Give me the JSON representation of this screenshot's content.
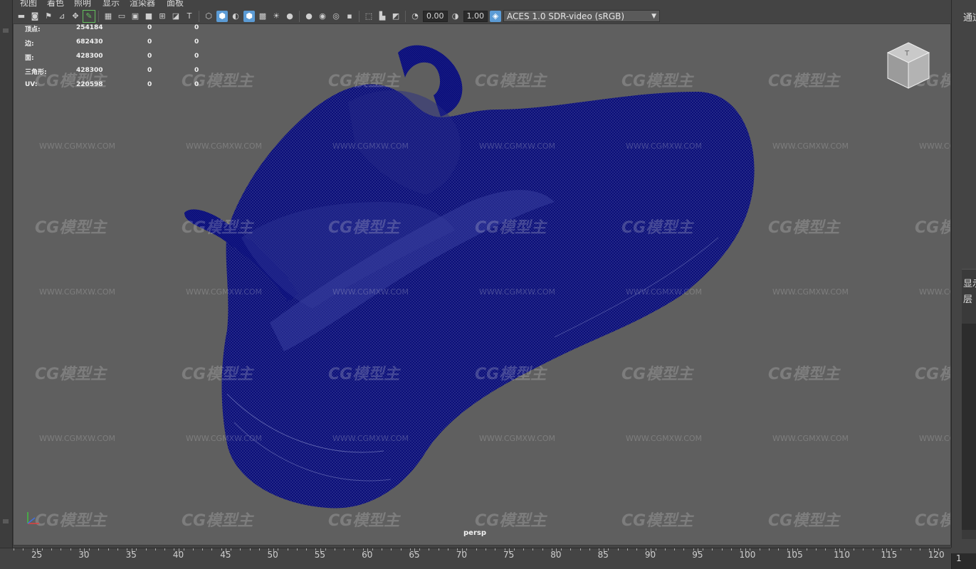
{
  "menu": [
    "视图",
    "着色",
    "照明",
    "显示",
    "渲染器",
    "面板"
  ],
  "toolbar": {
    "exposure_value": "0.00",
    "gamma_value": "1.00",
    "color_space": "ACES 1.0 SDR-video (sRGB)"
  },
  "hud": {
    "rows": [
      {
        "label": "顶点:",
        "v1": "254184",
        "v2": "0",
        "v3": "0"
      },
      {
        "label": "边:",
        "v1": "682430",
        "v2": "0",
        "v3": "0"
      },
      {
        "label": "面:",
        "v1": "428300",
        "v2": "0",
        "v3": "0"
      },
      {
        "label": "三角形:",
        "v1": "428300",
        "v2": "0",
        "v3": "0"
      },
      {
        "label": "UV:",
        "v1": "220598",
        "v2": "0",
        "v3": "0"
      }
    ]
  },
  "viewport": {
    "camera_label": "persp",
    "mesh_color": "#0c0f7a",
    "background_color": "#5f5f5f",
    "watermark_logo": "CG模型主",
    "watermark_url": "WWW.CGMXW.COM"
  },
  "right_panel": {
    "tab1": "通道",
    "tab2": "显示",
    "tab3": "层"
  },
  "timeline": {
    "labels": [
      "25",
      "30",
      "35",
      "40",
      "45",
      "50",
      "55",
      "60",
      "65",
      "70",
      "75",
      "80",
      "85",
      "90",
      "95",
      "100",
      "105",
      "110",
      "115",
      "120"
    ],
    "current_frame": "1"
  }
}
